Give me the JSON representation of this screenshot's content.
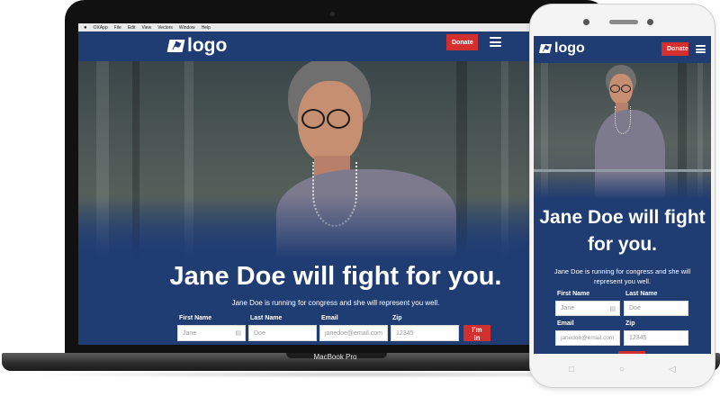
{
  "mac_menu": {
    "items": [
      "OXApp",
      "File",
      "Edit",
      "View",
      "Vectors",
      "Window",
      "Help"
    ]
  },
  "site": {
    "logo_text": "logo",
    "donate_label": "Donate",
    "headline_laptop": "Jane Doe will fight for you.",
    "headline_phone": "Jane Doe will fight for you.",
    "subtext": "Jane Doe is running for congress and she will represent you well.",
    "form": {
      "first_name_label": "First Name",
      "first_name_value": "Jane",
      "last_name_label": "Last Name",
      "last_name_value": "Doe",
      "email_label": "Email",
      "email_value": "janedoe@email.com",
      "zip_label": "Zip",
      "zip_value": "12345",
      "submit_label": "I'm in"
    }
  },
  "laptop_brand": "MacBook Pro",
  "icons": {
    "logo_mark": "stylized-flag-icon",
    "menu": "hamburger-menu-icon",
    "autofill": "contact-card-icon",
    "apple": "apple-logo-icon"
  },
  "phone_nav": {
    "recent": "□",
    "home": "○",
    "back": "◁"
  },
  "colors": {
    "brand_navy": "#1f3c73",
    "accent_red": "#d32f2f",
    "text_white": "#ffffff"
  }
}
